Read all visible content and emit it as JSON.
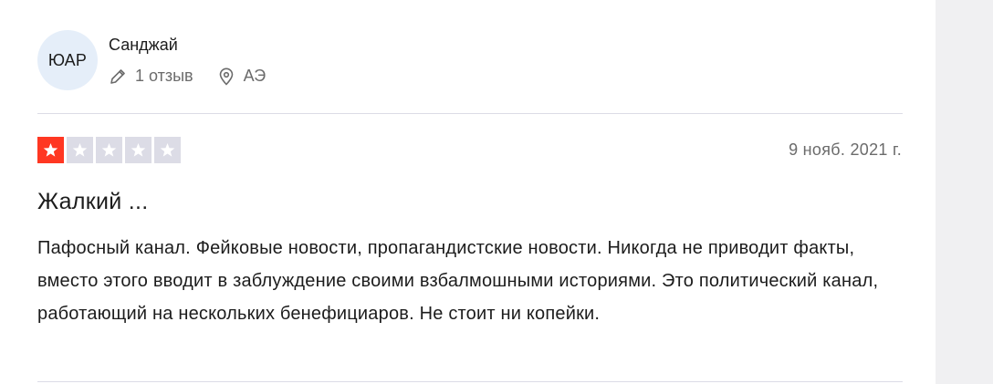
{
  "reviewer": {
    "initials": "ЮАР",
    "name": "Санджай",
    "reviews_count": "1 отзыв",
    "country": "АЭ",
    "review_count_icon": "pencil-icon",
    "country_icon": "location-pin-icon"
  },
  "review": {
    "rating": 1,
    "rating_max": 5,
    "date": "9 нояб. 2021 г.",
    "title": "Жалкий ...",
    "body": "Пафосный канал. Фейковые новости, пропагандистские новости. Никогда не приводит факты, вместо этого вводит в заблуждение своими взбалмошными историями. Это политический канал, работающий на нескольких бенефициаров. Не стоит ни копейки."
  },
  "colors": {
    "star_filled": "#ff3722",
    "star_empty": "#dcdce6",
    "avatar_bg": "#e5eef9",
    "muted_text": "#6b6b6b"
  }
}
